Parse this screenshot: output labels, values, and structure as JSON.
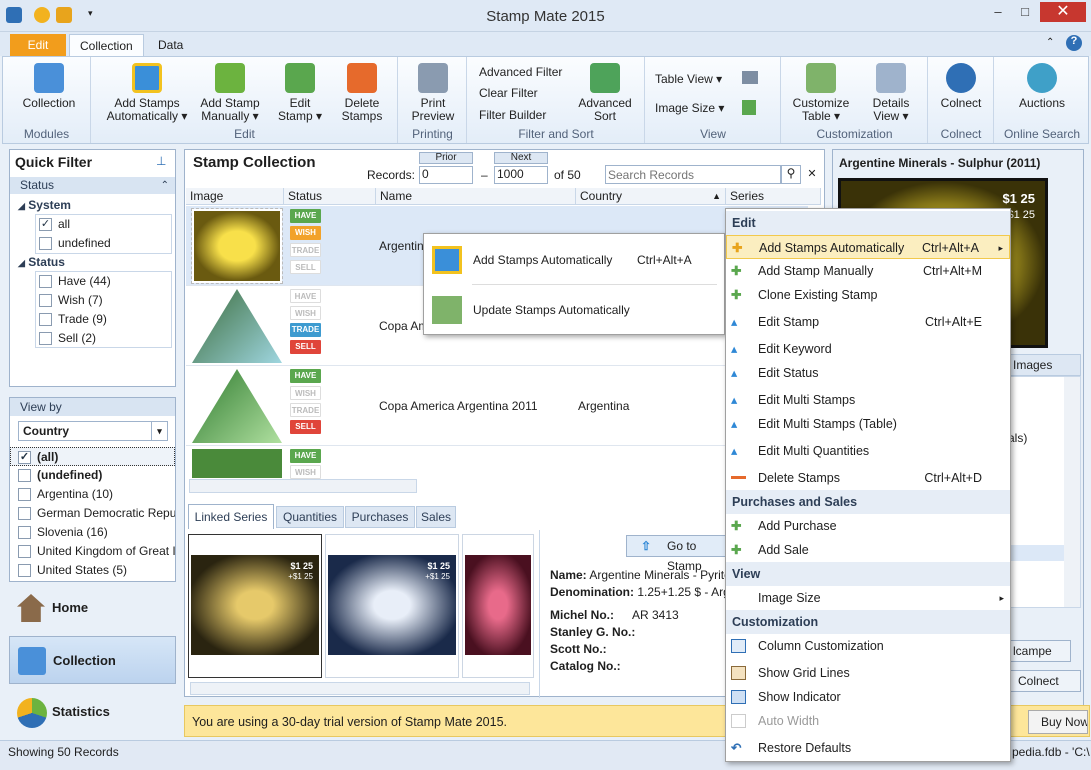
{
  "window": {
    "title": "Stamp Mate 2015",
    "minimize": "–",
    "maximize": "□",
    "close": "✕"
  },
  "ribbon_tabs": [
    "Edit",
    "Collection",
    "Data"
  ],
  "ribbon": {
    "collection": "Collection",
    "modules": "Modules",
    "add_auto": "Add Stamps",
    "add_auto2": "Automatically ▾",
    "add_manual": "Add Stamp",
    "add_manual2": "Manually ▾",
    "edit_stamp": "Edit",
    "edit_stamp2": "Stamp ▾",
    "delete": "Delete",
    "delete2": "Stamps",
    "edit_group": "Edit",
    "print": "Print",
    "print2": "Preview",
    "printing": "Printing",
    "adv_filter": "Advanced Filter",
    "clear_filter": "Clear Filter",
    "filter_builder": "Filter Builder",
    "adv_sort": "Advanced",
    "adv_sort2": "Sort",
    "filter_sort": "Filter and Sort",
    "table_view": "Table View ▾",
    "image_size": "Image Size ▾",
    "view": "View",
    "cust_table": "Customize",
    "cust_table2": "Table ▾",
    "details": "Details",
    "details2": "View ▾",
    "customization": "Customization",
    "colnect": "Colnect",
    "colnect_group": "Colnect",
    "auctions": "Auctions",
    "online": "Online Search"
  },
  "quick_filter": {
    "title": "Quick Filter",
    "status_header": "Status",
    "system": "System",
    "sys_items": [
      "all",
      "undefined"
    ],
    "status": "Status",
    "status_items": [
      "Have (44)",
      "Wish (7)",
      "Trade (9)",
      "Sell (2)"
    ]
  },
  "view_by": {
    "title": "View by",
    "selected": "Country",
    "items": [
      "(all)",
      "(undefined)",
      "Argentina  (10)",
      "German Democratic Repub",
      "Slovenia  (16)",
      "United Kingdom of Great I",
      "United States  (5)"
    ]
  },
  "nav": [
    "Home",
    "Collection",
    "Statistics"
  ],
  "collection": {
    "title": "Stamp Collection",
    "prior": "Prior",
    "next": "Next",
    "records_label": "Records:",
    "from": "0",
    "to": "1000",
    "of": "of 50",
    "search_placeholder": "Search Records",
    "columns": [
      "Image",
      "Status",
      "Name",
      "Country",
      "Series"
    ],
    "rows": [
      {
        "name": "Argentin",
        "country": "",
        "badges": [
          "HAVE",
          "WISH",
          "TRADE",
          "SELL"
        ]
      },
      {
        "name": "Copa Am",
        "country": "",
        "badges": [
          "HAVE",
          "WISH",
          "TRADE",
          "SELL"
        ]
      },
      {
        "name": "Copa America Argentina 2011",
        "country": "Argentina",
        "badges": [
          "HAVE",
          "WISH",
          "TRADE",
          "SELL"
        ]
      },
      {
        "name": "",
        "country": "",
        "badges": [
          "HAVE",
          "WISH"
        ]
      }
    ]
  },
  "bottom_tabs": [
    "Linked Series",
    "Quantities",
    "Purchases",
    "Sales"
  ],
  "details": {
    "goto": "Go to Stamp",
    "name_label": "Name:",
    "name": "Argentine Minerals - Pyrite",
    "denom_label": "Denomination:",
    "denom": "1.25+1.25 $ - Argentin",
    "michel_label": "Michel No.:",
    "michel": "AR 3413",
    "stanley_label": "Stanley G. No.:",
    "scott_label": "Scott No.:",
    "catalog_label": "Catalog No.:"
  },
  "stamp_values": {
    "a": "$1 25",
    "b": "+$1 25"
  },
  "right_panel": {
    "title": "Argentine Minerals - Sulphur (2011)",
    "tab_images": "Images",
    "partial": "als)",
    "btn1": "lcampe",
    "btn2": "Colnect"
  },
  "trial": {
    "text": "You are using a 30-day trial version of Stamp Mate 2015.",
    "buy": "Buy Now"
  },
  "status_bar": {
    "records": "Showing 50 Records",
    "path": "pedia.fdb - 'C:\\"
  },
  "submenu": [
    {
      "label": "Add Stamps Automatically",
      "shortcut": "Ctrl+Alt+A"
    },
    {
      "label": "Update Stamps Automatically",
      "shortcut": ""
    }
  ],
  "context_menu": {
    "edit": "Edit",
    "edit_items": [
      {
        "label": "Add Stamps Automatically",
        "shortcut": "Ctrl+Alt+A"
      },
      {
        "label": "Add Stamp Manually",
        "shortcut": "Ctrl+Alt+M"
      },
      {
        "label": "Clone Existing Stamp",
        "shortcut": ""
      },
      {
        "label": "Edit Stamp",
        "shortcut": "Ctrl+Alt+E"
      },
      {
        "label": "Edit Keyword",
        "shortcut": ""
      },
      {
        "label": "Edit Status",
        "shortcut": ""
      },
      {
        "label": "Edit Multi Stamps",
        "shortcut": ""
      },
      {
        "label": "Edit Multi Stamps (Table)",
        "shortcut": ""
      },
      {
        "label": "Edit Multi Quantities",
        "shortcut": ""
      },
      {
        "label": "Delete Stamps",
        "shortcut": "Ctrl+Alt+D"
      }
    ],
    "purchases": "Purchases and Sales",
    "purchase_items": [
      "Add Purchase",
      "Add Sale"
    ],
    "view": "View",
    "view_items": [
      "Image Size"
    ],
    "customization": "Customization",
    "cust_items": [
      "Column Customization",
      "Show Grid Lines",
      "Show Indicator",
      "Auto Width",
      "Restore Defaults"
    ]
  }
}
